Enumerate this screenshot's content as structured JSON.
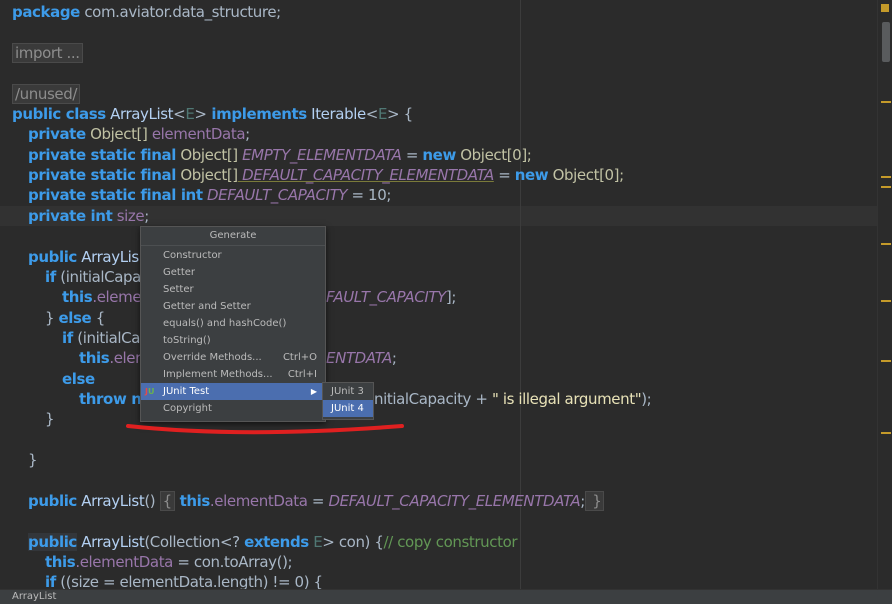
{
  "code": {
    "l1": {
      "kw": "package",
      "rest": " com.aviator.data_structure;"
    },
    "l3": {
      "fold": "import ..."
    },
    "l5": {
      "fold": "/unused/"
    },
    "l6": {
      "kw1": "public class",
      "cls": " ArrayList",
      "lt": "<",
      "gen": "E",
      "gt": ">",
      "kw2": " implements",
      "iter": " Iterable",
      "lt2": "<",
      "gen2": "E",
      "gt2": ">",
      "brace": " {"
    },
    "l7": {
      "kw": "private",
      "ty": " Object[]",
      "fld": " elementData",
      "end": ";"
    },
    "l8": {
      "kw": "private static final",
      "ty": " Object[]",
      "cst": " EMPTY_ELEMENTDATA",
      "eq": " = ",
      "kw2": "new",
      "rest": " Object[0];"
    },
    "l9": {
      "kw": "private static final",
      "ty": " Object[]",
      "cst": " DEFAULT_CAPACITY_ELEMENTDATA",
      "eq": " = ",
      "kw2": "new",
      "rest": " Object[0];"
    },
    "l10": {
      "kw": "private static final int",
      "cst": " DEFAULT_CAPACITY",
      "rest": " = 10;"
    },
    "l11": {
      "kw": "private int",
      "fld": " size",
      "end": ";"
    },
    "l12": {
      "kw": "public",
      "cls": " ArrayLis"
    },
    "l13": {
      "kw": "if",
      "rest": " (initialCapa"
    },
    "l14": {
      "kw": "this",
      "fld": ".eleme",
      "cst": "FAULT_CAPACITY",
      "end": "];"
    },
    "l15": {
      "pre": "} ",
      "kw": "else",
      "rest": " {"
    },
    "l16": {
      "kw": "if",
      "rest": " (initialCa"
    },
    "l17": {
      "kw": "this",
      "fld": ".elem",
      "cst": "ENTDATA",
      "end": ";"
    },
    "l18": {
      "kw": "else"
    },
    "l19": {
      "kw": "throw n",
      "rest": "nitialCapacity + ",
      "str": "\" is illegal argument\"",
      "end": ");"
    },
    "l20": {
      "text": "}"
    },
    "l22": {
      "text": "}"
    },
    "l24": {
      "kw": "public",
      "cls": " ArrayList",
      "p": "() ",
      "fold1": "{",
      "kw2": " this",
      "fld": ".elementData",
      "eq": " = ",
      "cst": "DEFAULT_CAPACITY_ELEMENTDATA",
      "end": ";",
      "fold2": " }"
    },
    "l26": {
      "kw": "public",
      "cls": " ArrayList",
      "p": "(Collection<? ",
      "kw2": "extends",
      "gen": " E",
      "rest": "> con) {",
      "cm": "// copy constructor"
    },
    "l27": {
      "kw": "this",
      "fld": ".elementData",
      "rest": " = con.toArray();"
    },
    "l28": {
      "kw": "if",
      "rest": " ((size = elementData.length) != 0) {"
    }
  },
  "popup": {
    "title": "Generate",
    "items": [
      {
        "label": "Constructor",
        "shortcut": ""
      },
      {
        "label": "Getter",
        "shortcut": ""
      },
      {
        "label": "Setter",
        "shortcut": ""
      },
      {
        "label": "Getter and Setter",
        "shortcut": ""
      },
      {
        "label": "equals() and hashCode()",
        "shortcut": ""
      },
      {
        "label": "toString()",
        "shortcut": ""
      },
      {
        "label": "Override Methods...",
        "shortcut": "Ctrl+O"
      },
      {
        "label": "Implement Methods...",
        "shortcut": "Ctrl+I"
      },
      {
        "label": "JUnit Test",
        "shortcut": ""
      },
      {
        "label": "Copyright",
        "shortcut": ""
      }
    ],
    "junit_icon": {
      "j": "J",
      "u": "U"
    },
    "submenu": [
      "JUnit 3",
      "JUnit 4"
    ]
  },
  "status": {
    "text": "ArrayList"
  },
  "colors": {
    "annotation": "#e02020",
    "selection": "#4b6eaf",
    "marker": "#c49a2a"
  }
}
